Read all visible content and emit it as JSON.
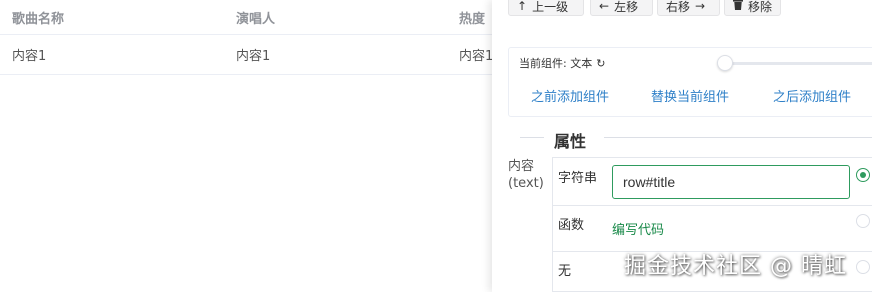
{
  "table": {
    "headers": [
      "歌曲名称",
      "演唱人",
      "热度"
    ],
    "rows": [
      [
        "内容1",
        "内容1",
        "内容1"
      ]
    ]
  },
  "toolbar": {
    "up_icon": "arrow-up-icon",
    "up_label": "上一级",
    "left_icon": "arrow-left-icon",
    "left_label": "左移",
    "right_label": "右移",
    "right_icon": "arrow-right-icon",
    "remove_icon": "trash-icon",
    "remove_label": "移除"
  },
  "component": {
    "current_label": "当前组件: 文本",
    "refresh_icon": "refresh-icon",
    "slider_value": 0,
    "actions": [
      "之前添加组件",
      "替换当前组件",
      "之后添加组件"
    ]
  },
  "properties": {
    "section_title": "属性",
    "prop_label": "内容",
    "prop_key": "(text)",
    "options": [
      {
        "name": "字符串",
        "value": "row#title",
        "selected": true
      },
      {
        "name": "函数",
        "link": "编写代码",
        "selected": false
      },
      {
        "name": "无",
        "selected": false
      }
    ]
  },
  "colors": {
    "accent_green": "#2e9b5e",
    "link_blue": "#2f80c8"
  },
  "watermark": "掘金技术社区 @ 晴虹"
}
